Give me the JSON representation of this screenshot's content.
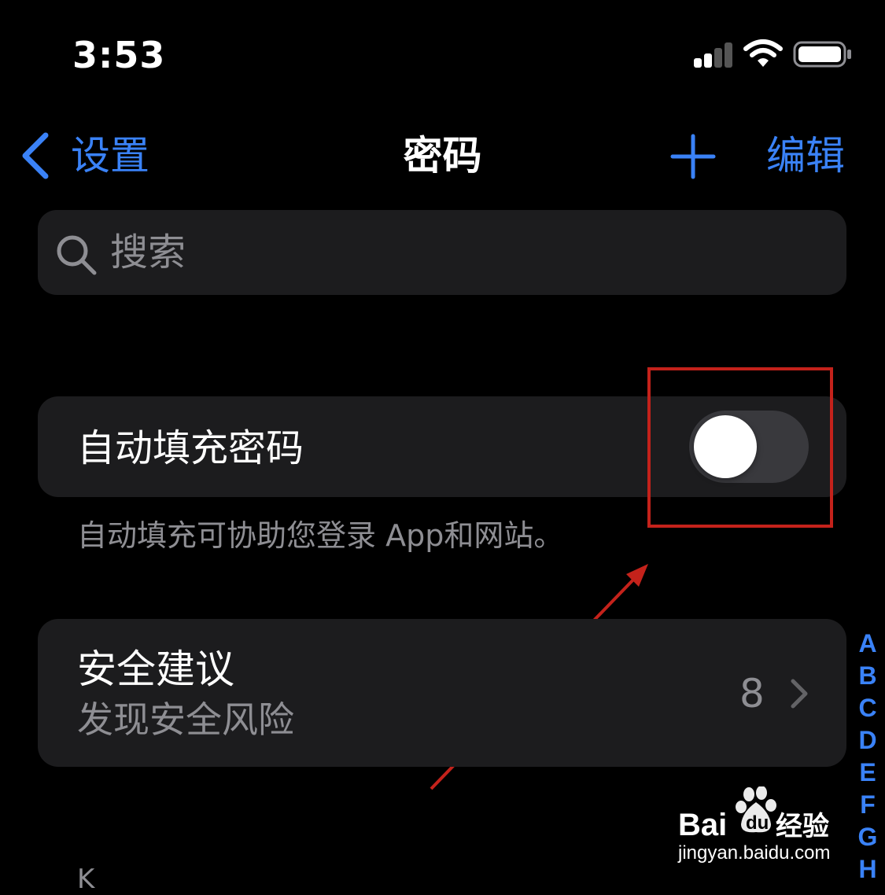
{
  "status_bar": {
    "time": "3:53"
  },
  "nav": {
    "back_label": "设置",
    "title": "密码",
    "edit_label": "编辑"
  },
  "search": {
    "placeholder": "搜索"
  },
  "autofill": {
    "label": "自动填充密码",
    "enabled": false,
    "description": "自动填充可协助您登录 App和网站。"
  },
  "security": {
    "title": "安全建议",
    "subtitle": "发现安全风险",
    "count": "8"
  },
  "index_letters": [
    "A",
    "B",
    "C",
    "D",
    "E",
    "F",
    "G",
    "H"
  ],
  "section_peek": "K",
  "watermark": {
    "logo_text": "Bai du 经验",
    "url": "jingyan.baidu.com"
  },
  "colors": {
    "accent": "#3a82f7",
    "annotation_red": "#c4221b",
    "card_bg": "#1c1c1e",
    "toggle_off": "#39393d"
  },
  "icons": {
    "status": [
      "cellular-signal-icon",
      "wifi-icon",
      "battery-icon"
    ],
    "nav": [
      "chevron-left-icon",
      "plus-icon"
    ],
    "search": "search-icon",
    "row": "chevron-right-icon"
  }
}
